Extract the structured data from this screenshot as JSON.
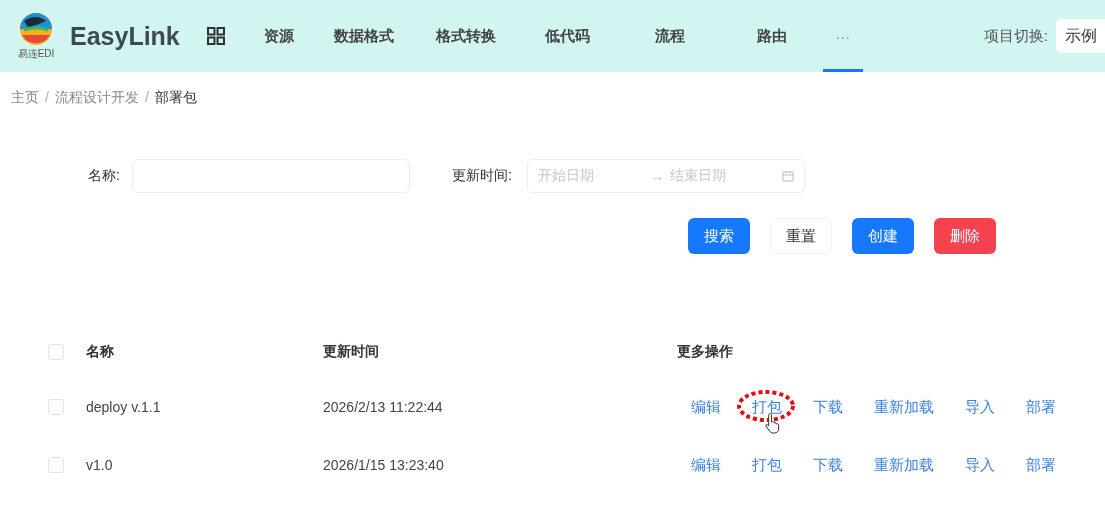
{
  "header": {
    "logo_caption": "易连EDI",
    "brand": "EasyLink",
    "nav": [
      {
        "label": "资源",
        "selected": false
      },
      {
        "label": "数据格式",
        "selected": false
      },
      {
        "label": "格式转换",
        "selected": false
      },
      {
        "label": "低代码",
        "selected": false
      },
      {
        "label": "流程",
        "selected": false
      },
      {
        "label": "路由",
        "selected": false
      },
      {
        "label": "···",
        "selected": true
      }
    ],
    "project_label": "项目切换:",
    "project_value": "示例"
  },
  "breadcrumb": [
    {
      "kind": "link",
      "label": "主页",
      "current": false
    },
    {
      "kind": "separator",
      "label": "/"
    },
    {
      "kind": "link",
      "label": "流程设计开发",
      "current": false
    },
    {
      "kind": "separator",
      "label": "/"
    },
    {
      "kind": "link",
      "label": "部署包",
      "current": true
    }
  ],
  "filters": {
    "name_label": "名称:",
    "time_label": "更新时间:",
    "start_placeholder": "开始日期",
    "range_arrow": "→",
    "end_placeholder": "结束日期"
  },
  "buttons": [
    {
      "label": "搜索",
      "kind": "primary"
    },
    {
      "label": "重置",
      "kind": "default"
    },
    {
      "label": "创建",
      "kind": "primary"
    },
    {
      "label": "删除",
      "kind": "danger"
    }
  ],
  "table": {
    "select_all_checked": false,
    "columns": [
      "名称",
      "更新时间",
      "更多操作"
    ],
    "rows": [
      {
        "checked": false,
        "name": "deploy v.1.1",
        "time": "2026/2/13 11:22:44",
        "actions": [
          {
            "label": "编辑",
            "highlighted": false
          },
          {
            "label": "打包",
            "highlighted": true
          },
          {
            "label": "下载",
            "highlighted": false
          },
          {
            "label": "重新加载",
            "highlighted": false
          },
          {
            "label": "导入",
            "highlighted": false
          },
          {
            "label": "部署",
            "highlighted": false
          }
        ]
      },
      {
        "checked": false,
        "name": "v1.0",
        "time": "2026/1/15 13:23:40",
        "actions": [
          {
            "label": "编辑",
            "highlighted": false
          },
          {
            "label": "打包",
            "highlighted": false
          },
          {
            "label": "下载",
            "highlighted": false
          },
          {
            "label": "重新加载",
            "highlighted": false
          },
          {
            "label": "导入",
            "highlighted": false
          },
          {
            "label": "部署",
            "highlighted": false
          }
        ]
      }
    ]
  }
}
